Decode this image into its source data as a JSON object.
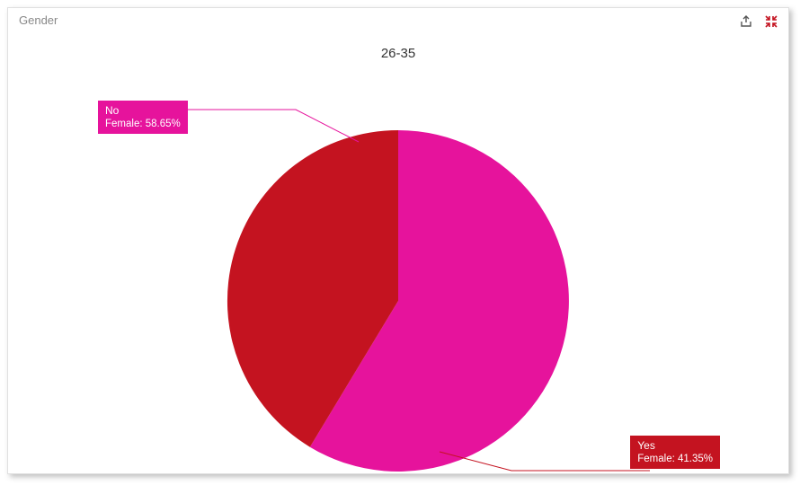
{
  "panel": {
    "title": "Gender"
  },
  "chart_data": {
    "type": "pie",
    "title": "26-35",
    "series": [
      {
        "name": "No",
        "subgroup": "Female",
        "value": 58.65,
        "color": "#E6139C"
      },
      {
        "name": "Yes",
        "subgroup": "Female",
        "value": 41.35,
        "color": "#C41320"
      }
    ],
    "labels": {
      "no": {
        "line1": "No",
        "line2": "Female: 58.65%"
      },
      "yes": {
        "line1": "Yes",
        "line2": "Female: 41.35%"
      }
    }
  },
  "colors": {
    "slice_no": "#E6139C",
    "slice_yes": "#C41320",
    "export_icon": "#555555",
    "collapse_icon": "#C41320"
  }
}
